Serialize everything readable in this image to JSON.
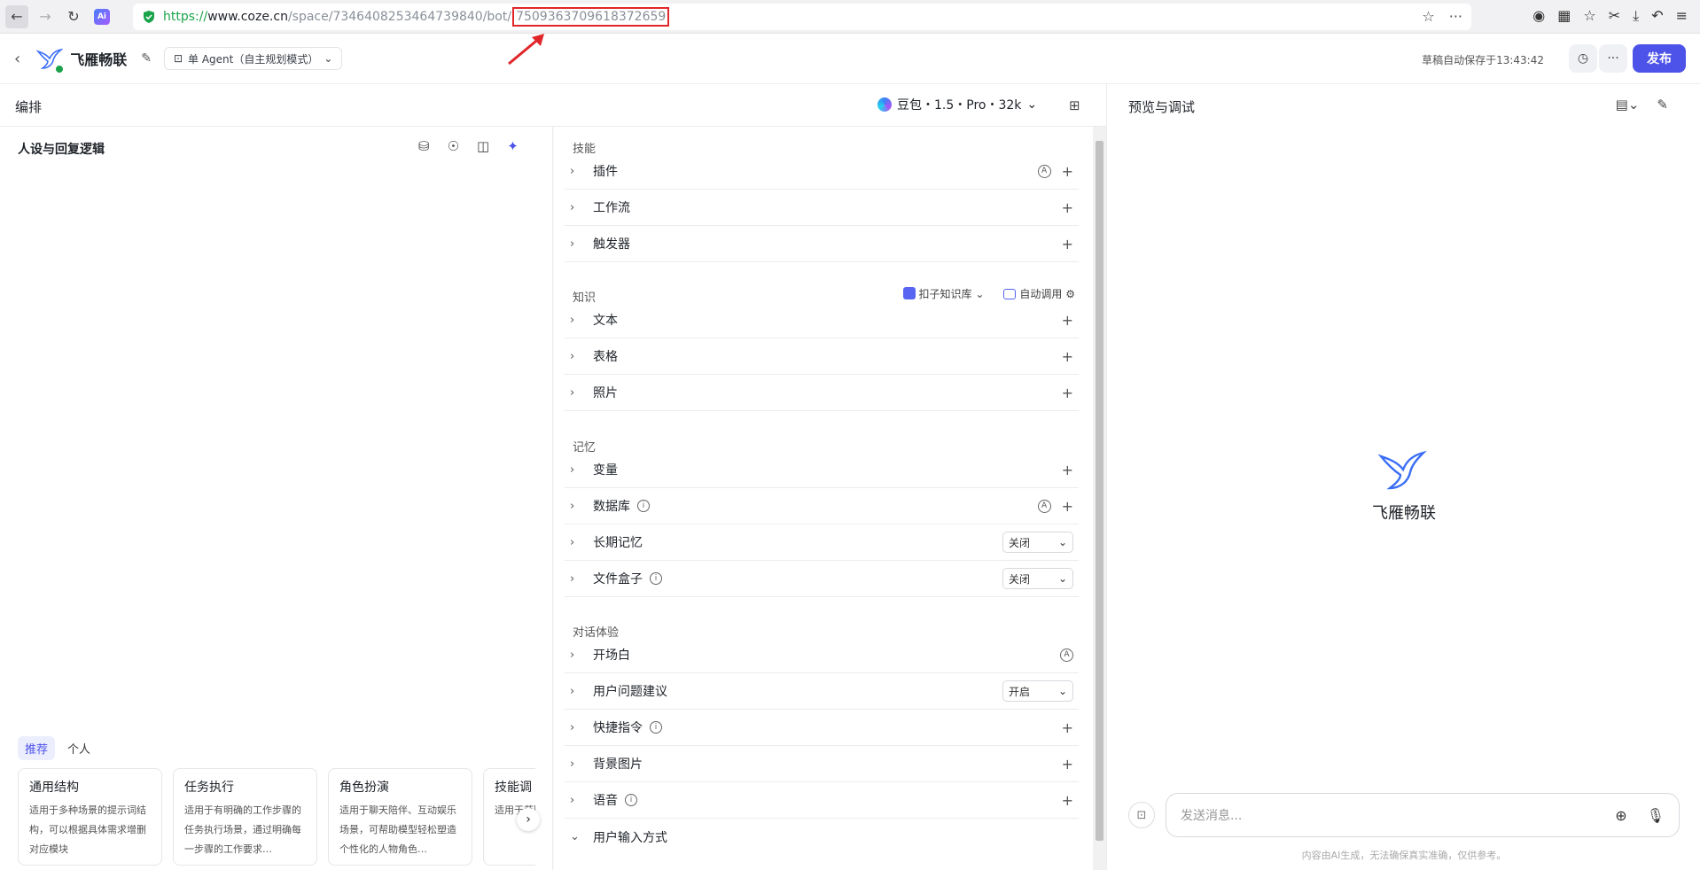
{
  "browser": {
    "url_scheme": "https://",
    "url_host": "www.coze.cn",
    "url_path": "/space/7346408253464739840/bot/",
    "url_id": "7509363709618372659",
    "ai_badge": "Ai"
  },
  "header": {
    "bot_name": "飞雁畅联",
    "mode_label": "单 Agent（自主规划模式）",
    "save_status": "草稿自动保存于13:43:42",
    "publish_label": "发布"
  },
  "editor": {
    "title": "编排",
    "model": "豆包・1.5・Pro・32k"
  },
  "persona": {
    "title": "人设与回复逻辑",
    "tabs": [
      "推荐",
      "个人"
    ],
    "cards": [
      {
        "title": "通用结构",
        "desc": "适用于多种场景的提示词结构，可以根据具体需求增删对应模块"
      },
      {
        "title": "任务执行",
        "desc": "适用于有明确的工作步骤的任务执行场景，通过明确每一步骤的工作要求…"
      },
      {
        "title": "角色扮演",
        "desc": "适用于聊天陪伴、互动娱乐场景，可帮助模型轻松塑造个性化的人物角色…"
      },
      {
        "title": "技能调",
        "desc": "适用于获取的场景"
      }
    ]
  },
  "skills": {
    "section_skills": "技能",
    "plugin": "插件",
    "workflow": "工作流",
    "trigger": "触发器",
    "section_knowledge": "知识",
    "kb_source": "扣子知识库",
    "kb_auto": "自动调用",
    "text": "文本",
    "table": "表格",
    "photo": "照片",
    "section_memory": "记忆",
    "variable": "变量",
    "database": "数据库",
    "long_memory": "长期记忆",
    "long_memory_value": "关闭",
    "file_box": "文件盒子",
    "file_box_value": "关闭",
    "section_dialog": "对话体验",
    "opening": "开场白",
    "suggestions": "用户问题建议",
    "suggestions_value": "开启",
    "shortcuts": "快捷指令",
    "background": "背景图片",
    "voice": "语音",
    "input_mode": "用户输入方式",
    "auto_badge": "A",
    "info_badge": "i"
  },
  "preview": {
    "title": "预览与调试",
    "bot_name": "飞雁畅联",
    "input_placeholder": "发送消息...",
    "disclaimer": "内容由AI生成，无法确保真实准确，仅供参考。"
  },
  "colors": {
    "accent": "#4d53e8",
    "url_highlight": "#e0262a",
    "secure": "#1aa34a"
  }
}
